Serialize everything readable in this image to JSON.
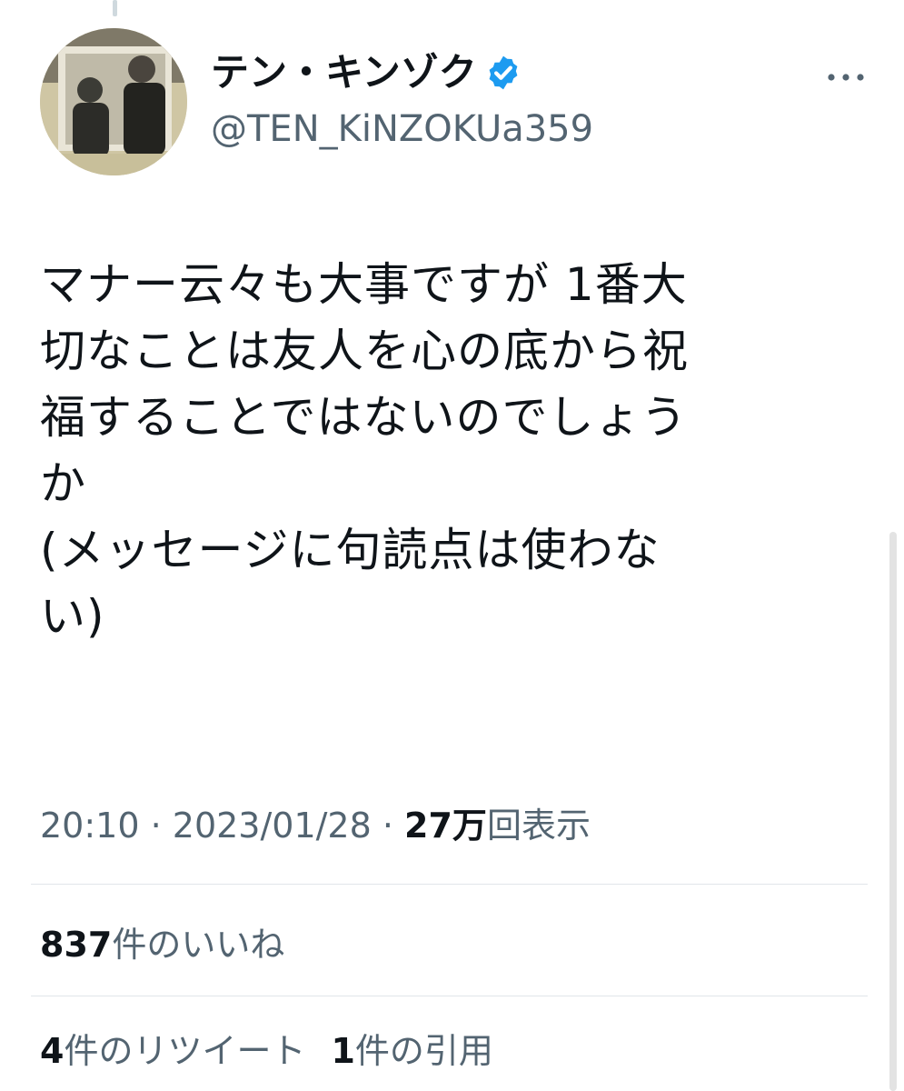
{
  "tweet": {
    "author": {
      "display_name": "テン・キンゾク",
      "handle": "@TEN_KiNZOKUa359",
      "verified": true
    },
    "text": "マナー云々も大事ですが 1番大\n切なことは友人を心の底から祝\n福することではないのでしょう\nか\n(メッセージに句読点は使わな\nい)",
    "time": "20:10",
    "date": "2023/01/28",
    "views_count": "27万",
    "views_label": "回表示",
    "separator": " · "
  },
  "stats": {
    "likes_count": "837",
    "likes_label": "件のいいね",
    "retweets_count": "4",
    "retweets_label": "件のリツイート",
    "quotes_count": "1",
    "quotes_label": "件の引用"
  },
  "icons": {
    "verified": "verified-badge-icon",
    "more": "more-horizontal-icon"
  },
  "colors": {
    "text_primary": "#0f1419",
    "text_secondary": "#536471",
    "verified_blue": "#1d9bf0",
    "divider": "#e1e6ea"
  }
}
